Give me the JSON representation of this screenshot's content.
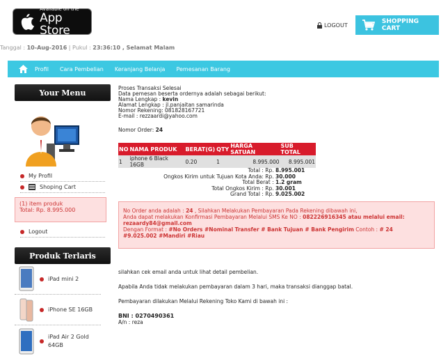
{
  "header": {
    "appstore_small": "Available on the",
    "appstore_big": "App Store",
    "logout": "LOGOUT",
    "shopping_cart": "SHOPPING CART"
  },
  "date_line": {
    "label_tanggal": "Tanggal : ",
    "date": "10-Aug-2016",
    "sep": " | Pukul : ",
    "time": "23:36:10 , Selamat Malam"
  },
  "nav": {
    "items": [
      "Profil",
      "Cara Pembelian",
      "Keranjang Belanja",
      "Pemesanan Barang"
    ]
  },
  "sidebar": {
    "your_menu": "Your Menu",
    "menu": [
      "My Profil",
      "Shoping Cart",
      "Logout"
    ],
    "cart_box_line1": "(1) item produk",
    "cart_box_line2": "Total: Rp. 8.995.000",
    "best_title": "Produk Terlaris",
    "products": [
      "iPad mini 2",
      "iPhone SE 16GB",
      "iPad Air 2 Gold",
      "64GB"
    ]
  },
  "order": {
    "intro1": "Proses Transaksi Selesai",
    "intro2": "Data pemesan beserta ordernya adalah sebagai berikut:",
    "name_label": "Nama Lengkap  : ",
    "name_value": "kevin",
    "address": "Alamat Lengkap  : jl.panjaitan samarinda",
    "rekening": "Nomor Rekening: 081828167721",
    "email": "E-mail           : rezzaardi@yahoo.com",
    "order_no_label": "Nomor Order: ",
    "order_no": "24",
    "table_headers": [
      "NO",
      "NAMA PRODUK",
      "BERAT(G)",
      "QTY",
      "HARGA SATUAN",
      "SUB TOTAL"
    ],
    "rows": [
      [
        "1",
        "iphone 6 Black 16GB",
        "0.20",
        "1",
        "8.995.000",
        "8.995.001"
      ]
    ],
    "totals": [
      {
        "label": "Total : Rp.",
        "value": "8.995.001"
      },
      {
        "label": "Ongkos Kirim untuk Tujuan Kota Anda: Rp.",
        "value": "30.000"
      },
      {
        "label": "Total Berat :",
        "value": "1.2 gram"
      },
      {
        "label": "Total Ongkos Kirim : Rp.",
        "value": "30.001"
      },
      {
        "label": "Grand Total : Rp.",
        "value": "9.025.002"
      }
    ]
  },
  "payment_box": {
    "line1_a": "No Order anda adalah : ",
    "line1_order": "24",
    "line1_b": " , Silahkan Melakukan Pembayaran Pada Rekening dibawah ini,",
    "line2_a": "Anda dapat melakukan Konfirmasi Pembayaran Melalui SMS Ke NO : ",
    "line2_b": "082226916345 atau melalui email:",
    "line3": "rezaardy84@gmail.com",
    "line4_a": "Dengan Format : ",
    "line4_b": "#No Orders #Nominal Transfer # Bank Tujuan # Bank Pengirim",
    "line4_c": " Contoh : ",
    "line4_d": "# 24",
    "line5": "#9.025.002 #Mandiri #Riau"
  },
  "bottom": {
    "line1": "silahkan cek email anda untuk lihat detail pembelian.",
    "line2": "Apabila Anda tidak melakukan pembayaran dalam 3 hari, maka transaksi dianggap batal.",
    "line3": "Pembayaran dilakukan Melalui Rekening Toko Kami di bawah ini :",
    "bank": "BNI :  0270490361",
    "an": "A/n : reza"
  },
  "colors": {
    "accent": "#3cc8e2",
    "table_header": "#d81b2b",
    "alert_bg": "#fde0e0",
    "alert_text": "#cc3333"
  }
}
